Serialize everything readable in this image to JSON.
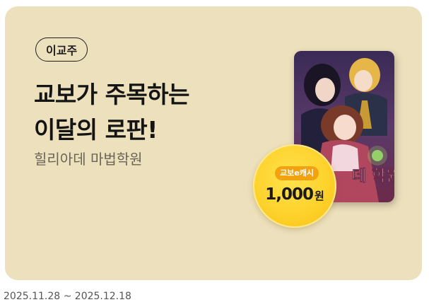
{
  "banner": {
    "badge": "이교주",
    "headline_line1": "교보가 주목하는",
    "headline_line2": "이달의 로판!",
    "book_title": "힐리아데 마법학원",
    "cover_text": "데 학원",
    "coin": {
      "label": "교보e캐시",
      "amount": "1,000",
      "unit": "원"
    },
    "period": "2025.11.28 ~ 2025.12.18"
  },
  "colors": {
    "card_background": "#ede0bc",
    "coin_yellow": "#fdd12a",
    "coin_label_orange": "#f2a20f",
    "text_dark": "#141414"
  },
  "icons": [
    "book-cover-illustration",
    "cash-coin-icon"
  ]
}
